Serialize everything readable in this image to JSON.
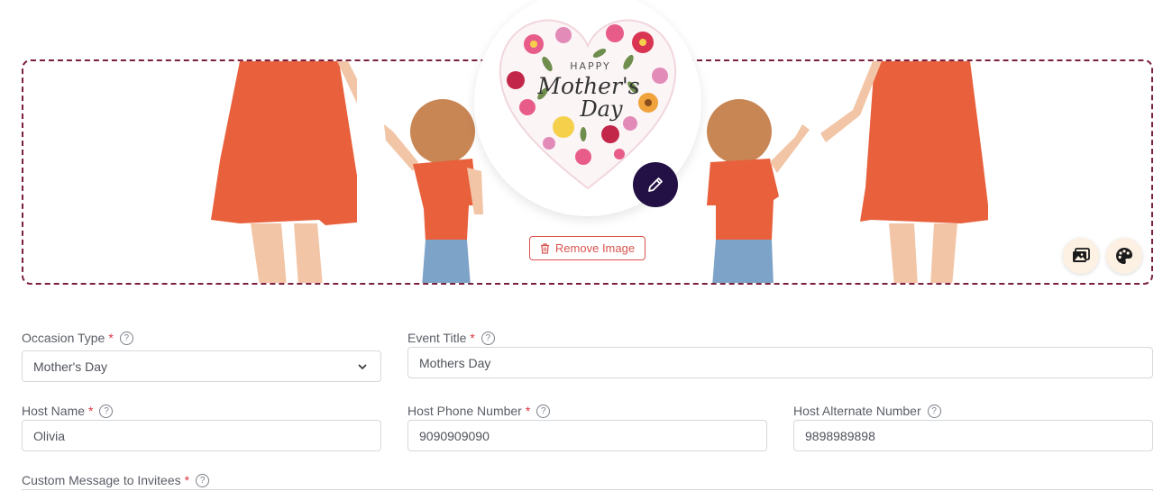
{
  "banner": {
    "remove_image_label": "Remove Image",
    "avatar_text_line1": "HAPPY",
    "avatar_text_line2": "Mother's",
    "avatar_text_line3": "Day",
    "icons": [
      "pencil-icon",
      "trash-icon",
      "image-icon",
      "palette-icon"
    ],
    "border_color": "#7b1f3e",
    "edit_button_color": "#231044",
    "remove_color": "#d9534f"
  },
  "form": {
    "occasion_type": {
      "label": "Occasion Type",
      "required": "*",
      "value": "Mother's Day"
    },
    "event_title": {
      "label": "Event Title",
      "required": "*",
      "value": "Mothers Day"
    },
    "host_name": {
      "label": "Host Name",
      "required": "*",
      "value": "Olivia"
    },
    "host_phone": {
      "label": "Host Phone Number",
      "required": "*",
      "value": "9090909090"
    },
    "host_alt": {
      "label": "Host Alternate Number",
      "value": "9898989898"
    },
    "custom_message": {
      "label": "Custom Message to Invitees",
      "required": "*"
    },
    "help_glyph": "?"
  }
}
